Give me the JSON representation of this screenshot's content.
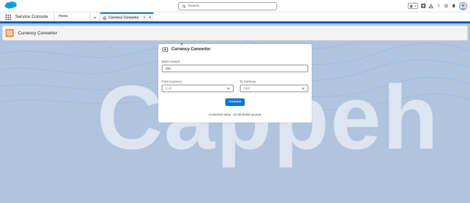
{
  "global_header": {
    "search_placeholder": "Search...",
    "icons": [
      "favorites-star-icon",
      "favorites-dropdown-icon",
      "global-actions-icon",
      "trailhead-icon",
      "help-icon",
      "setup-gear-icon",
      "notifications-bell-icon",
      "user-avatar"
    ]
  },
  "nav": {
    "app_name": "Service Console",
    "home_label": "Home",
    "active_tab_label": "Currency Convertor"
  },
  "background": {
    "brand_word": "Cappeh"
  },
  "page_header": {
    "title": "Currency Convertor"
  },
  "converter": {
    "title": "Currency Convertor",
    "amount_label": "Enter Amount",
    "amount_value": "100",
    "from_label": "From Currency",
    "from_value": "CHF",
    "to_label": "To Currency",
    "to_value": "GBP",
    "convert_label": "Convert",
    "result_text": "Converted Value : 87.86 British pounds"
  },
  "colors": {
    "brand_blue": "#0176d3",
    "nav_stripe": "#0b5cab",
    "page_icon_orange": "#f49756",
    "background": "#b0c4df"
  }
}
